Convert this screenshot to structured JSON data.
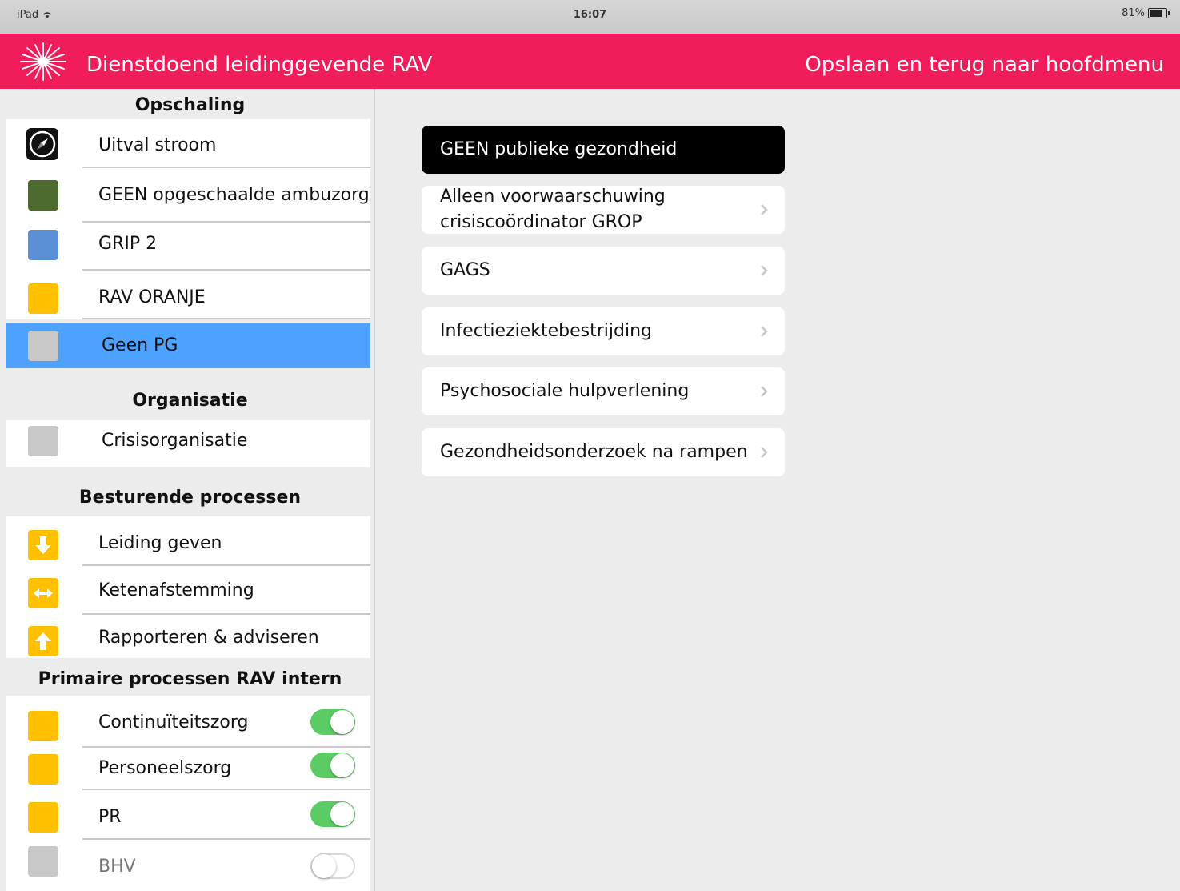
{
  "status_bar": {
    "device": "iPad",
    "wifi_icon": "wifi-icon",
    "time": "16:07",
    "battery": "81%",
    "battery_level": 0.81
  },
  "nav_bar": {
    "logo_icon": "burst-logo-icon",
    "title": "Dienstdoend leidinggevende RAV",
    "action_label": "Opslaan en terug naar hoofdmenu",
    "background": "#f01d5a"
  },
  "sidebar": {
    "opschaling": {
      "header": "Opschaling",
      "items": [
        {
          "label": "Uitval stroom",
          "icon": "compass-icon"
        },
        {
          "label": "GEEN opgeschaalde ambuzorg",
          "color": "#4d6b2f"
        },
        {
          "label": "GRIP 2",
          "color": "#5b8fd6"
        },
        {
          "label": "RAV ORANJE",
          "color": "#ffc000"
        },
        {
          "label": "Geen PG",
          "color": "#c8c8c8",
          "selected": true
        }
      ]
    },
    "organisatie": {
      "header": "Organisatie",
      "items": [
        {
          "label": "Crisisorganisatie",
          "color": "#c8c8c8"
        }
      ]
    },
    "besturende": {
      "header": "Besturende processen",
      "items": [
        {
          "label": "Leiding geven",
          "icon": "arrow-down-icon",
          "color": "#ffc000"
        },
        {
          "label": "Ketenafstemming",
          "icon": "arrows-horizontal-icon",
          "color": "#ffc000"
        },
        {
          "label": "Rapporteren & adviseren",
          "icon": "arrow-up-icon",
          "color": "#ffc000"
        }
      ]
    },
    "primaire": {
      "header": "Primaire processen RAV intern",
      "items": [
        {
          "label": "Continuïteitszorg",
          "color": "#ffc000",
          "toggle": true
        },
        {
          "label": "Personeelszorg",
          "color": "#ffc000",
          "toggle": true
        },
        {
          "label": "PR",
          "color": "#ffc000",
          "toggle": true
        },
        {
          "label": "BHV",
          "color": "#c8c8c8",
          "toggle": false
        }
      ]
    }
  },
  "detail": {
    "options": [
      {
        "label": "GEEN publieke gezondheid",
        "active": true
      },
      {
        "label": "Alleen voorwaarschuwing crisiscoördinator GROP"
      },
      {
        "label": "GAGS"
      },
      {
        "label": "Infectieziektebestrijding"
      },
      {
        "label": "Psychosociale hulpverlening"
      },
      {
        "label": "Gezondheidsonderzoek na rampen"
      }
    ]
  },
  "colors": {
    "toggle_on": "#5bcc64",
    "selected_row": "#4ea2ff"
  }
}
